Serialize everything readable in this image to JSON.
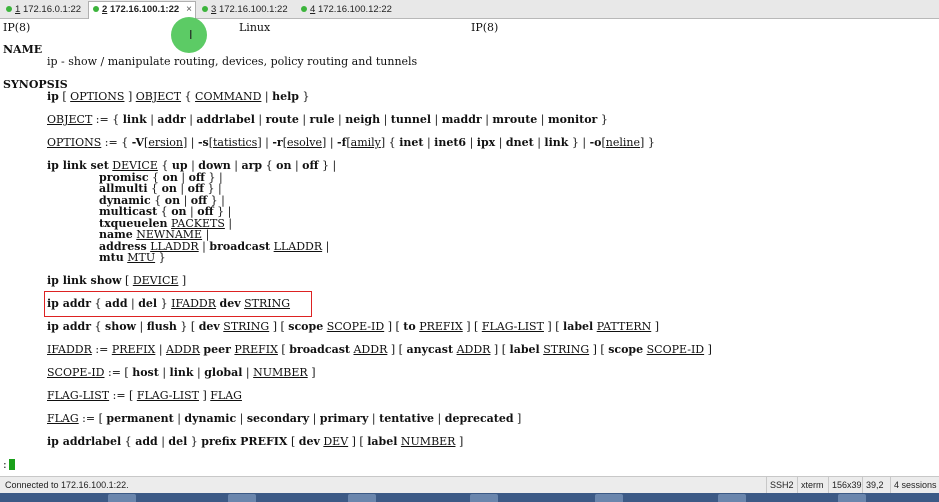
{
  "tabs": [
    {
      "num": "1",
      "host": "172.16.0.1:22"
    },
    {
      "num": "2",
      "host": "172.16.100.1:22",
      "close": "×"
    },
    {
      "num": "3",
      "host": "172.16.100.1:22"
    },
    {
      "num": "4",
      "host": "172.16.100.12:22"
    }
  ],
  "terminal": {
    "header_left": "IP(8)",
    "header_center": "Linux",
    "header_right": "IP(8)",
    "name_heading": "NAME",
    "name_desc": "ip - show / manipulate routing, devices, policy routing and tunnels",
    "synopsis_heading": "SYNOPSIS",
    "prompt": ":"
  },
  "status": {
    "connection": "Connected to 172.16.100.1:22.",
    "protocol": "SSH2",
    "term_type": "xterm",
    "size": "156x39",
    "position": "39,2",
    "sessions": "4 sessions"
  }
}
